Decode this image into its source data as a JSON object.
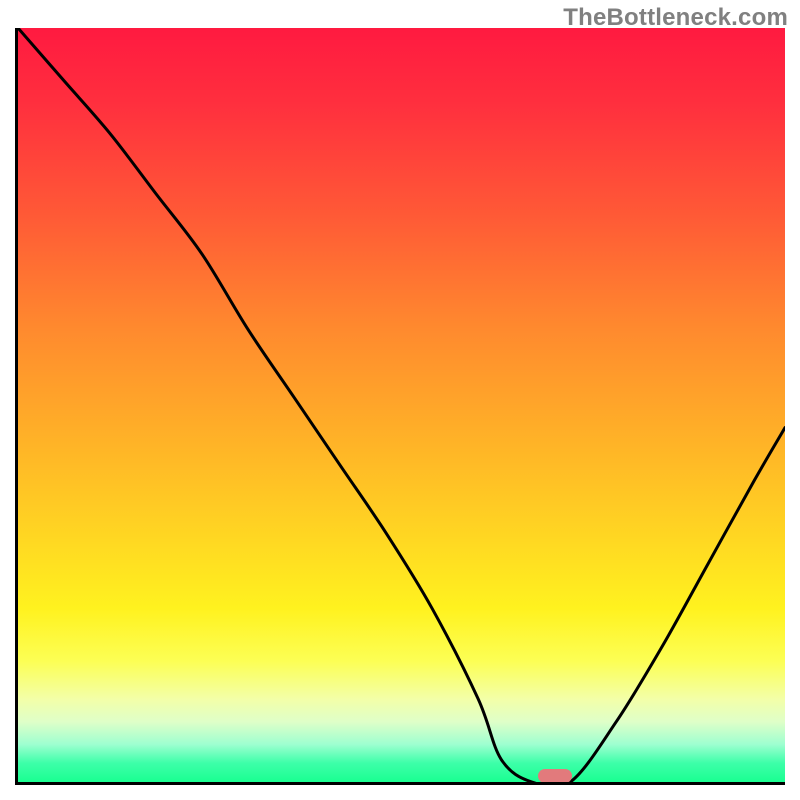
{
  "watermark": "TheBottleneck.com",
  "chart_data": {
    "type": "line",
    "title": "",
    "xlabel": "",
    "ylabel": "",
    "xlim": [
      0,
      100
    ],
    "ylim": [
      0,
      100
    ],
    "grid": false,
    "legend": false,
    "background": {
      "direction": "vertical",
      "meaning": "bottleneck severity (top = high/red, bottom = low/green)",
      "stops": [
        {
          "pos": 0,
          "color": "#ff1a40"
        },
        {
          "pos": 25,
          "color": "#ff5a36"
        },
        {
          "pos": 55,
          "color": "#ffb327"
        },
        {
          "pos": 77,
          "color": "#fff21f"
        },
        {
          "pos": 92,
          "color": "#dfffc8"
        },
        {
          "pos": 100,
          "color": "#1aff91"
        }
      ]
    },
    "series": [
      {
        "name": "bottleneck-curve",
        "x": [
          0,
          6,
          12,
          18,
          24,
          30,
          36,
          42,
          48,
          54,
          60,
          63,
          67,
          72,
          78,
          84,
          90,
          96,
          100
        ],
        "y": [
          100,
          93,
          86,
          78,
          70,
          60,
          51,
          42,
          33,
          23,
          11,
          3,
          0,
          0,
          8,
          18,
          29,
          40,
          47
        ]
      }
    ],
    "marker": {
      "name": "optimal-point",
      "x": 70,
      "y": 0,
      "color": "#e27a7c",
      "shape": "pill"
    }
  }
}
